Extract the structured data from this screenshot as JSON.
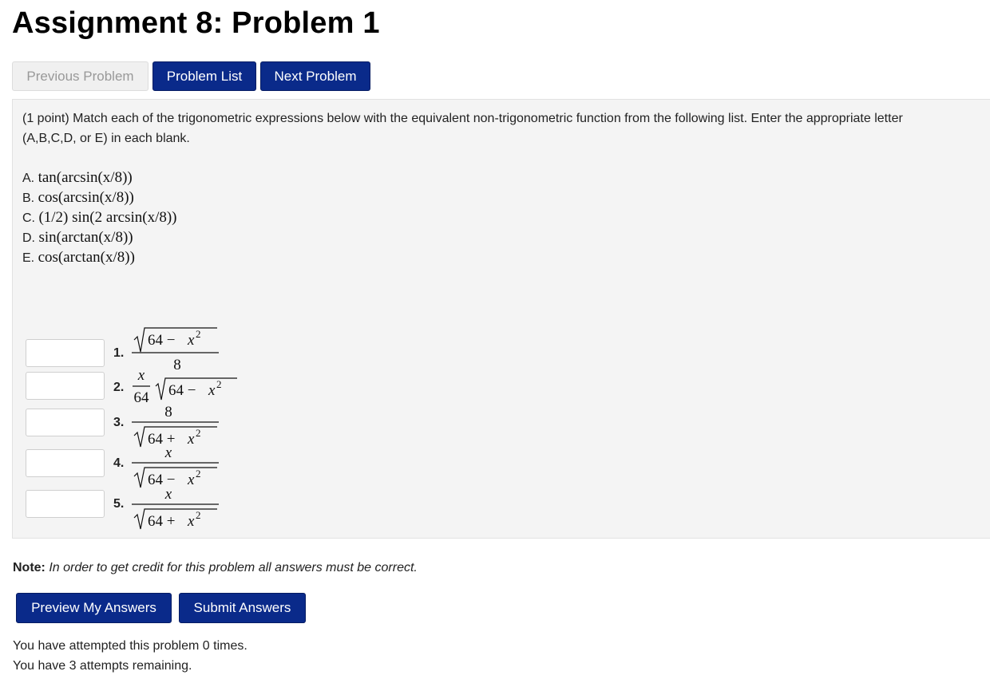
{
  "page_title": "Assignment 8: Problem 1",
  "nav": {
    "previous_label": "Previous Problem",
    "list_label": "Problem List",
    "next_label": "Next Problem"
  },
  "problem": {
    "intro_line1": "(1 point) Match each of the trigonometric expressions below with the equivalent non-trigonometric function from the following list. Enter the appropriate letter",
    "intro_line2": "(A,B,C,D, or E) in each blank.",
    "options": [
      {
        "letter": "A.",
        "expr": "tan(arcsin(x/8))"
      },
      {
        "letter": "B.",
        "expr": "cos(arcsin(x/8))"
      },
      {
        "letter": "C.",
        "expr": "(1/2) sin(2 arcsin(x/8))"
      },
      {
        "letter": "D.",
        "expr": "sin(arctan(x/8))"
      },
      {
        "letter": "E.",
        "expr": "cos(arctan(x/8))"
      }
    ],
    "answers": [
      {
        "number": "1.",
        "value": "",
        "placeholder": ""
      },
      {
        "number": "2.",
        "value": "",
        "placeholder": ""
      },
      {
        "number": "3.",
        "value": "",
        "placeholder": ""
      },
      {
        "number": "4.",
        "value": "",
        "placeholder": ""
      },
      {
        "number": "5.",
        "value": "",
        "placeholder": ""
      }
    ],
    "math": {
      "var": "x",
      "eight": "8",
      "sixtyfour": "64",
      "minus": "−",
      "plus": "+",
      "square": "2",
      "sixtyfour_minus": "64 −",
      "sixtyfour_plus": "64 +"
    }
  },
  "note": {
    "label": "Note:",
    "text": "In order to get credit for this problem all answers must be correct."
  },
  "actions": {
    "preview_label": "Preview My Answers",
    "submit_label": "Submit Answers"
  },
  "status": {
    "attempted": "You have attempted this problem 0 times.",
    "remaining": "You have 3 attempts remaining."
  },
  "colors": {
    "primary_button": "#0a2a8a",
    "problem_background": "#f4f4f4",
    "disabled_button": "#f0f0f0"
  }
}
